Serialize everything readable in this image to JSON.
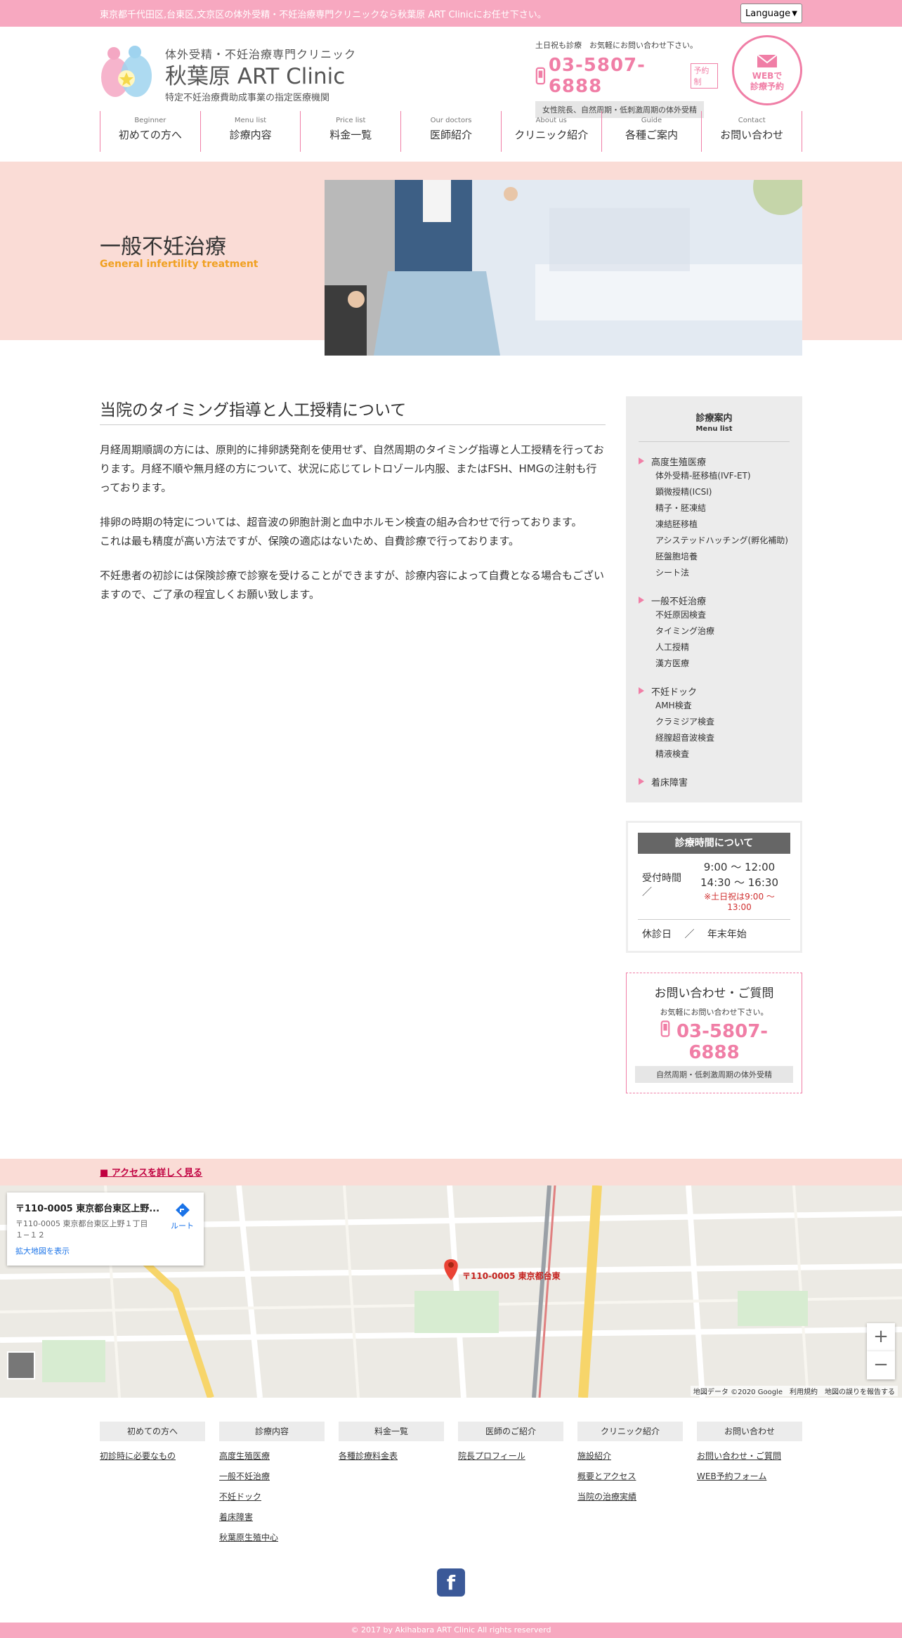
{
  "topbar": {
    "text": "東京都千代田区,台東区,文京区の体外受精・不妊治療専門クリニックなら秋葉原 ART Clinicにお任せ下さい。",
    "language": "Language"
  },
  "logo": {
    "sub1": "体外受精・不妊治療専門クリニック",
    "main": "秋葉原 ART Clinic",
    "sub2": "特定不妊治療費助成事業の指定医療機関"
  },
  "header": {
    "note": "土日祝も診療　お気軽にお問い合わせ下さい。",
    "phone": "03-5807-6888",
    "reserve": "予約制",
    "tag": "女性院長、自然周期・低刺激周期の体外受精",
    "web_line1": "WEBで",
    "web_line2": "診療予約"
  },
  "nav": [
    {
      "en": "Beginner",
      "ja": "初めての方へ"
    },
    {
      "en": "Menu list",
      "ja": "診療内容"
    },
    {
      "en": "Price list",
      "ja": "料金一覧"
    },
    {
      "en": "Our doctors",
      "ja": "医師紹介"
    },
    {
      "en": "About us",
      "ja": "クリニック紹介"
    },
    {
      "en": "Guide",
      "ja": "各種ご案内"
    },
    {
      "en": "Contact",
      "ja": "お問い合わせ"
    }
  ],
  "hero": {
    "title": "一般不妊治療",
    "subtitle": "General infertility treatment"
  },
  "content": {
    "heading": "当院のタイミング指導と人工授精について",
    "p1": "月経周期順調の方には、原則的に排卵誘発剤を使用せず、自然周期のタイミング指導と人工授精を行っております。月経不順や無月経の方について、状況に応じてレトロゾール内服、またはFSH、HMGの注射も行っております。",
    "p2a": "排卵の時期の特定については、超音波の卵胞計測と血中ホルモン検査の組み合わせで行っております。",
    "p2b": "これは最も精度が高い方法ですが、保険の適応はないため、自費診療で行っております。",
    "p3": "不妊患者の初診には保険診療で診察を受けることができますが、診療内容によって自費となる場合もございますので、ご了承の程宜しくお願い致します。"
  },
  "menu": {
    "title": "診療案内",
    "title_en": "Menu list",
    "groups": [
      {
        "label": "高度生殖医療",
        "items": [
          "体外受精-胚移植(IVF-ET)",
          "顕微授精(ICSI)",
          "精子・胚凍結",
          "凍結胚移植",
          "アシステッドハッチング(孵化補助)",
          "胚盤胞培養",
          "シート法"
        ]
      },
      {
        "label": "一般不妊治療",
        "items": [
          "不妊原因検査",
          "タイミング治療",
          "人工授精",
          "漢方医療"
        ]
      },
      {
        "label": "不妊ドック",
        "items": [
          "AMH検査",
          "クラミジア検査",
          "経膣超音波検査",
          "精液検査"
        ]
      },
      {
        "label": "着床障害",
        "items": []
      }
    ]
  },
  "hours": {
    "title": "診療時間について",
    "label": "受付時間 ／",
    "time1": "9:00 〜 12:00",
    "time2": "14:30 〜 16:30",
    "note": "※土日祝は9:00 〜 13:00",
    "closed": "休診日　 ／　 年末年始"
  },
  "inquiry": {
    "title": "お問い合わせ・ご質問",
    "sub": "お気軽にお問い合わせ下さい。",
    "phone": "03-5807-6888",
    "tag": "自然周期・低刺激周期の体外受精"
  },
  "access": {
    "link": "■ アクセスを詳しく見る"
  },
  "map": {
    "title": "〒110-0005 東京都台東区上野...",
    "address1": "〒110-0005 東京都台東区上野１丁目",
    "address2": "１−１２",
    "enlarge": "拡大地図を表示",
    "route": "ルート",
    "pin_label": "〒110-0005 東京都台東",
    "attribution": "地図データ ©2020 Google　利用規約　地図の誤りを報告する",
    "zoom_in": "+",
    "zoom_out": "−"
  },
  "footer": {
    "cols": [
      {
        "head": "初めての方へ",
        "links": [
          "初診時に必要なもの"
        ]
      },
      {
        "head": "診療内容",
        "links": [
          "高度生殖医療",
          "一般不妊治療",
          "不妊ドック",
          "着床障害",
          "秋葉原生殖中心"
        ]
      },
      {
        "head": "料金一覧",
        "links": [
          "各種診療料金表"
        ]
      },
      {
        "head": "医師のご紹介",
        "links": [
          "院長プロフィール"
        ]
      },
      {
        "head": "クリニック紹介",
        "links": [
          "施設紹介",
          "概要とアクセス",
          "当院の治療実績"
        ]
      },
      {
        "head": "お問い合わせ",
        "links": [
          "お問い合わせ・ご質問",
          "WEB予約フォーム"
        ]
      }
    ],
    "facebook": "f",
    "copyright": "© 2017 by Akihabara ART Clinic All rights reserverd"
  }
}
